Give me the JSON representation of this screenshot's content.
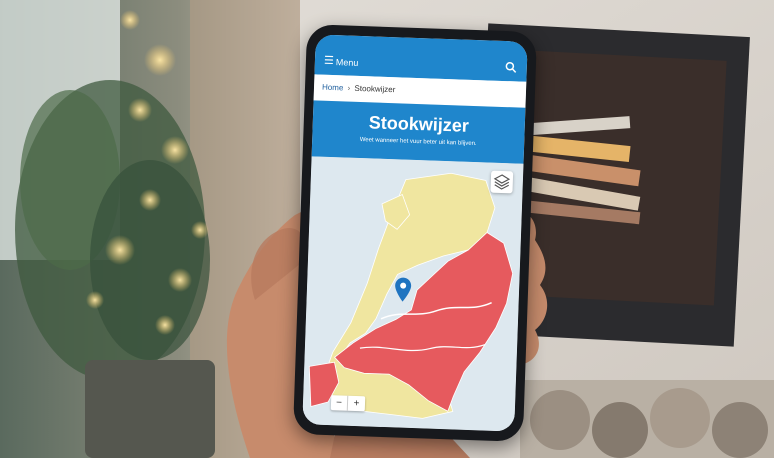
{
  "app": {
    "menu_label": "Menu",
    "breadcrumb": {
      "home": "Home",
      "separator": "›",
      "current": "Stookwijzer"
    },
    "title": "Stookwijzer",
    "subtitle": "Weet wanneer het vuur beter uit kan blijven.",
    "zoom_out_label": "−",
    "zoom_in_label": "+"
  },
  "colors": {
    "brand_blue": "#1f86cc",
    "map_red": "#e65a5e",
    "map_yellow": "#f0e6a0",
    "map_water": "#dde8ef",
    "marker_blue": "#1f74c0"
  },
  "icons": {
    "menu": "hamburger-icon",
    "search": "search-icon",
    "layers": "layers-icon",
    "marker": "map-marker-icon"
  }
}
